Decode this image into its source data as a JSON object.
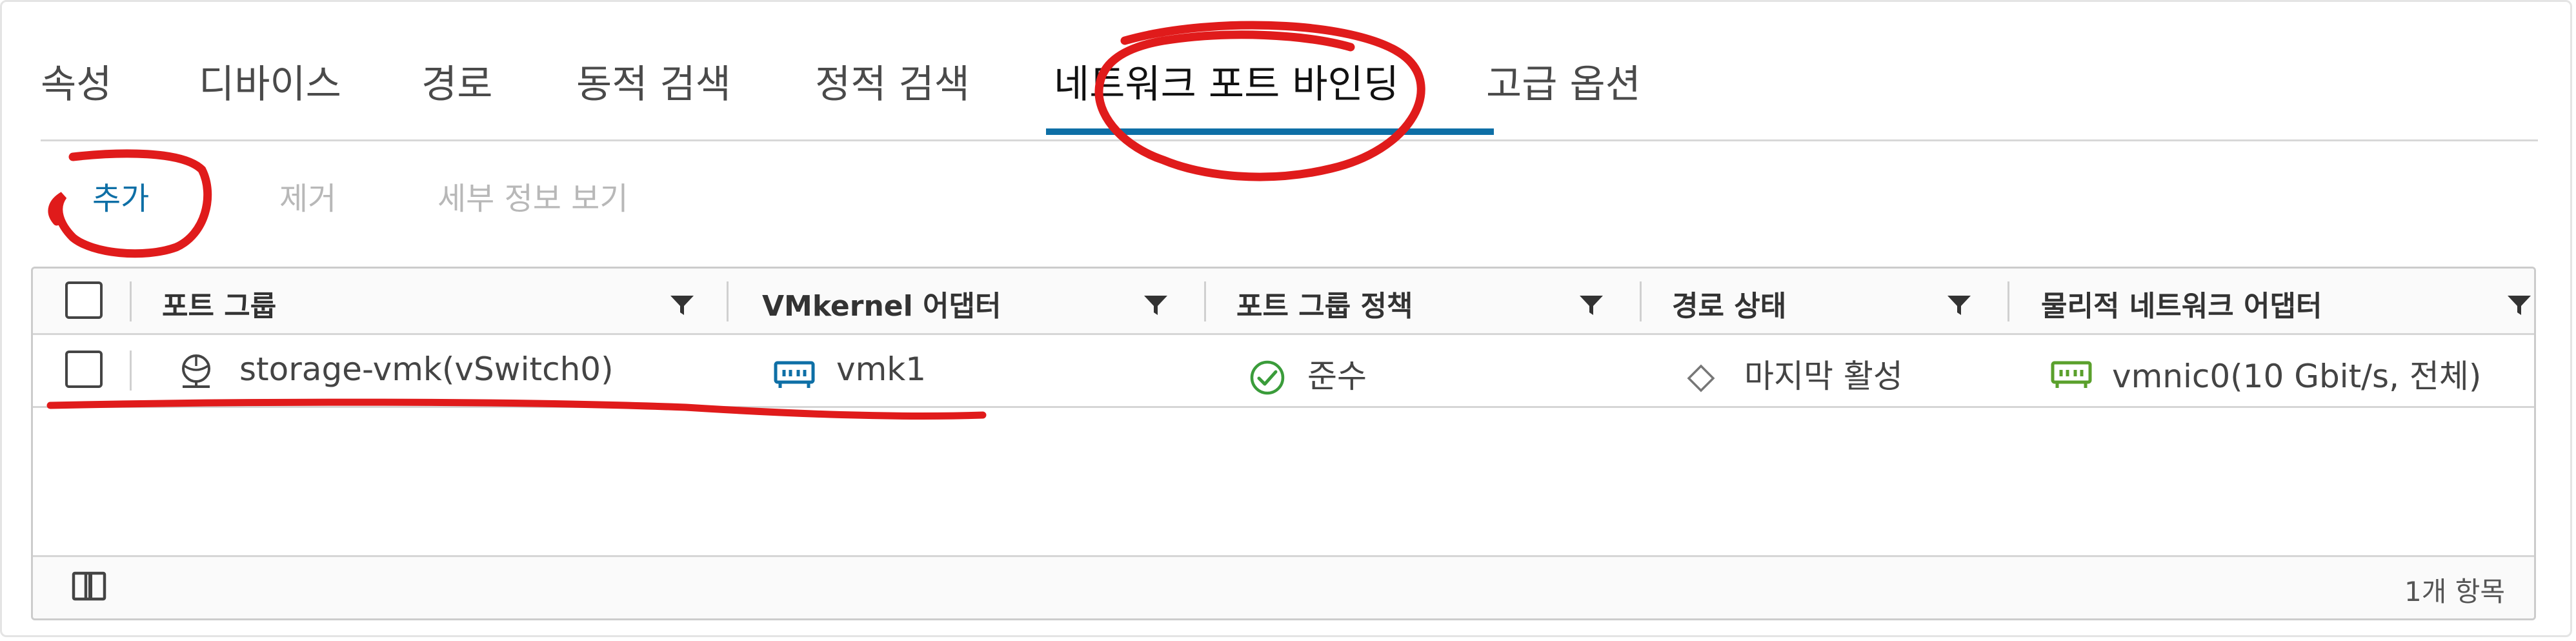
{
  "tabs": [
    {
      "label": "속성",
      "active": false
    },
    {
      "label": "디바이스",
      "active": false
    },
    {
      "label": "경로",
      "active": false
    },
    {
      "label": "동적 검색",
      "active": false
    },
    {
      "label": "정적 검색",
      "active": false
    },
    {
      "label": "네트워크 포트 바인딩",
      "active": true
    },
    {
      "label": "고급 옵션",
      "active": false
    }
  ],
  "toolbar": {
    "add_label": "추가",
    "remove_label": "제거",
    "details_label": "세부 정보 보기"
  },
  "grid": {
    "columns": [
      "포트 그룹",
      "VMkernel 어댑터",
      "포트 그룹 정책",
      "경로 상태",
      "물리적 네트워크 어댑터"
    ],
    "rows": [
      {
        "port_group": "storage-vmk(vSwitch0)",
        "vmkernel_adapter": "vmk1",
        "port_group_policy": "준수",
        "path_status": "마지막 활성",
        "physical_adapter": "vmnic0(10 Gbit/s, 전체)"
      }
    ],
    "footer_count": "1개 항목"
  },
  "colors": {
    "accent": "#0e6fa6",
    "status_ok": "#3a9c3a",
    "nic_green": "#5aa02c",
    "annotation_red": "#e01b1b"
  }
}
